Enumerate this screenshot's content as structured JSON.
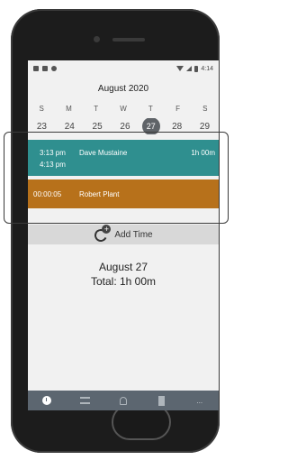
{
  "status_bar": {
    "time": "4:14"
  },
  "calendar": {
    "month": "August 2020",
    "weekdays": [
      "S",
      "M",
      "T",
      "W",
      "T",
      "F",
      "S"
    ],
    "dates": [
      "23",
      "24",
      "25",
      "26",
      "27",
      "28",
      "29"
    ],
    "selected": "27"
  },
  "entries": [
    {
      "start": "3:13 pm",
      "end": "4:13 pm",
      "name": "Dave Mustaine",
      "duration": "1h 00m",
      "color": "#2f8f8f"
    },
    {
      "time": "00:00:05",
      "name": "Robert Plant",
      "color": "#b7711b"
    }
  ],
  "add_time": {
    "label": "Add Time"
  },
  "summary": {
    "date": "August 27",
    "total": "Total: 1h 00m"
  },
  "bottom_nav": {
    "items": [
      "clock-icon",
      "list-icon",
      "bell-icon",
      "book-icon",
      "more"
    ],
    "more_label": "..."
  }
}
